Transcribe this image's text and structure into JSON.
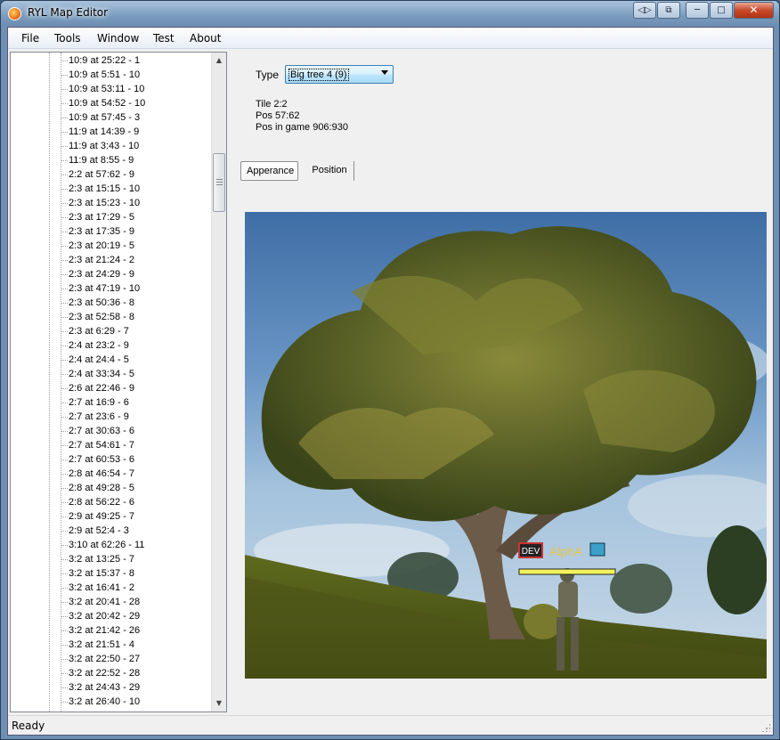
{
  "window": {
    "title": "RYL Map Editor",
    "controls": {
      "extra1": "◁▷",
      "extra2": "⧉",
      "minimize": "─",
      "maximize": "□",
      "close": "✕"
    }
  },
  "menu": [
    "File",
    "Tools",
    "Window",
    "Test",
    "About"
  ],
  "tree": {
    "items": [
      "10:9 at 25:22 - 1",
      "10:9 at 5:51 - 10",
      "10:9 at 53:11 - 10",
      "10:9 at 54:52 - 10",
      "10:9 at 57:45 - 3",
      "11:9 at 14:39 - 9",
      "11:9 at 3:43 - 10",
      "11:9 at 8:55 - 9",
      "2:2 at 57:62 - 9",
      "2:3 at 15:15 - 10",
      "2:3 at 15:23 - 10",
      "2:3 at 17:29 - 5",
      "2:3 at 17:35 - 9",
      "2:3 at 20:19 - 5",
      "2:3 at 21:24 - 2",
      "2:3 at 24:29 - 9",
      "2:3 at 47:19 - 10",
      "2:3 at 50:36 - 8",
      "2:3 at 52:58 - 8",
      "2:3 at 6:29 - 7",
      "2:4 at 23:2 - 9",
      "2:4 at 24:4 - 5",
      "2:4 at 33:34 - 5",
      "2:6 at 22:46 - 9",
      "2:7 at 16:9 - 6",
      "2:7 at 23:6 - 9",
      "2:7 at 30:63 - 6",
      "2:7 at 54:61 - 7",
      "2:7 at 60:53 - 6",
      "2:8 at 46:54 - 7",
      "2:8 at 49:28 - 5",
      "2:8 at 56:22 - 6",
      "2:9 at 49:25 - 7",
      "2:9 at 52:4 - 3",
      "3:10 at 62:26 - 11",
      "3:2 at 13:25 - 7",
      "3:2 at 15:37 - 8",
      "3:2 at 16:41 - 2",
      "3:2 at 20:41 - 28",
      "3:2 at 20:42 - 29",
      "3:2 at 21:42 - 26",
      "3:2 at 21:51 - 4",
      "3:2 at 22:50 - 27",
      "3:2 at 22:52 - 28",
      "3:2 at 24:43 - 29",
      "3:2 at 26:40 - 10"
    ],
    "scroll_up": "▲",
    "scroll_down": "▼"
  },
  "details": {
    "type_label": "Type",
    "type_value": "Big tree 4 (9)",
    "tile": "Tile 2:2",
    "pos": "Pos 57:62",
    "pos_in_game": "Pos in game 906:930"
  },
  "tabs": {
    "appearance": "Apperance",
    "position": "Position"
  },
  "preview": {
    "nameplate_tag": "DEV",
    "nameplate_name": "AlphA"
  },
  "status": {
    "text": "Ready"
  }
}
